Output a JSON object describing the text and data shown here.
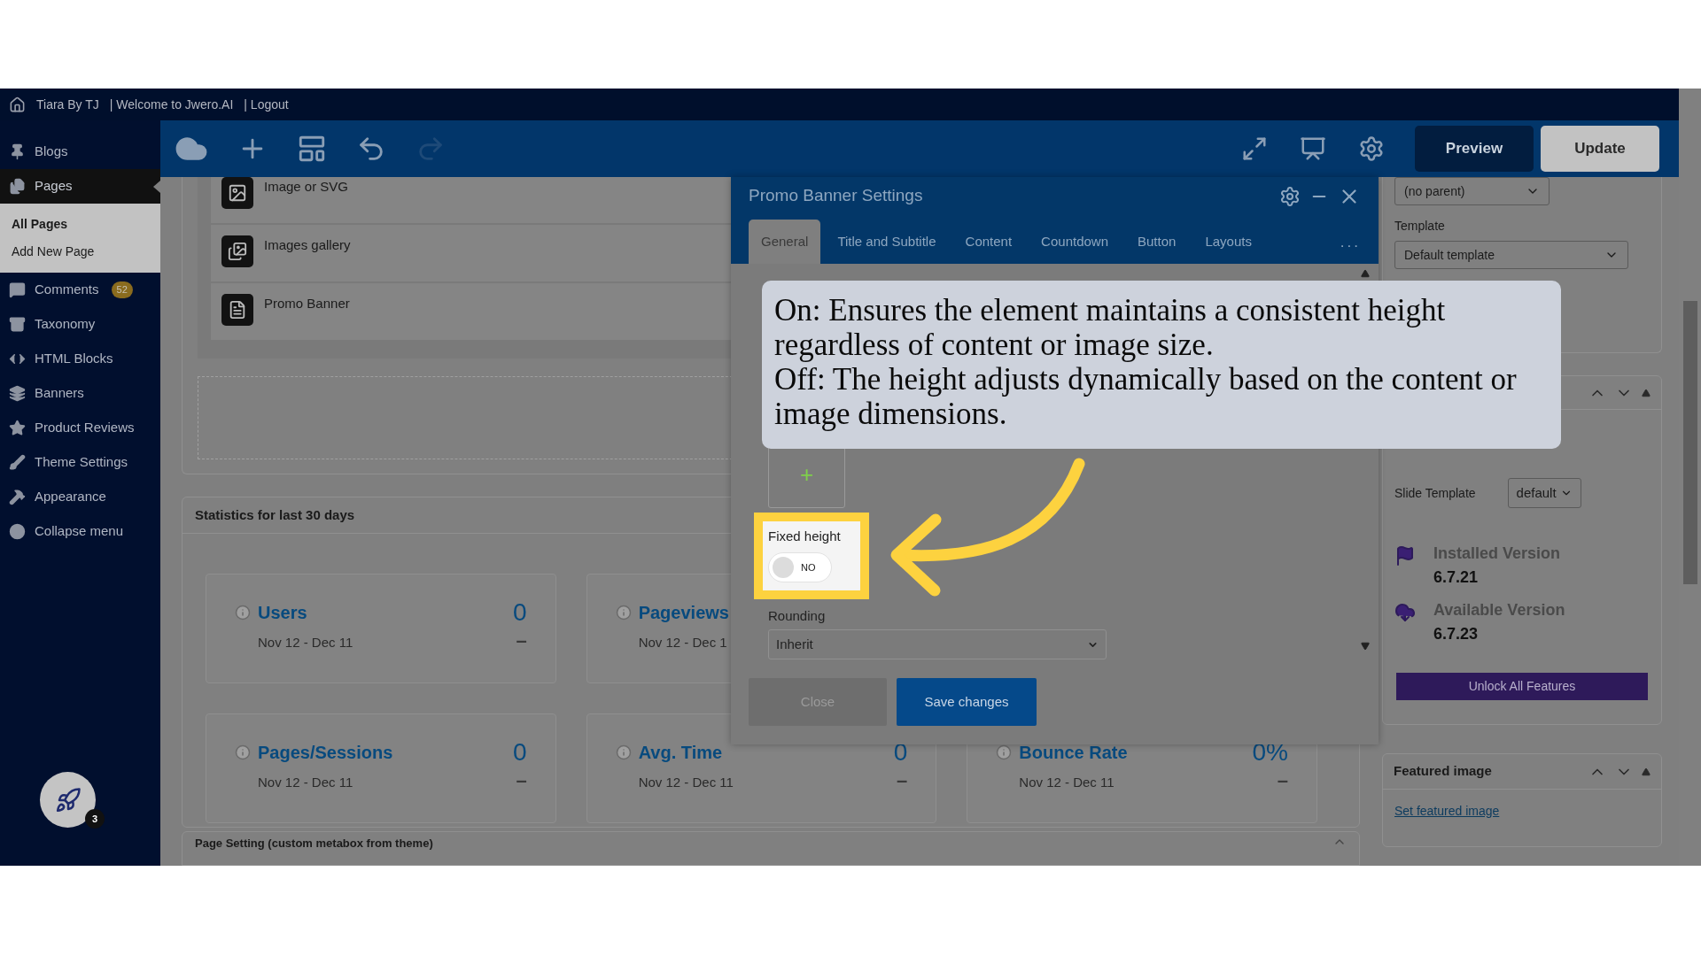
{
  "admin_bar": {
    "items": [
      "Tiara By TJ",
      "| Welcome to Jwero.AI",
      "| Logout"
    ]
  },
  "sidebar": {
    "items": [
      {
        "label": "Blogs",
        "selected": false
      },
      {
        "label": "Pages",
        "selected": true,
        "children": [
          {
            "label": "All Pages",
            "selected": true
          },
          {
            "label": "Add New Page",
            "selected": false
          }
        ]
      },
      {
        "label": "Comments",
        "selected": false,
        "badge": "52"
      },
      {
        "label": "Taxonomy",
        "selected": false
      },
      {
        "label": "HTML Blocks",
        "selected": false
      },
      {
        "label": "Banners",
        "selected": false
      },
      {
        "label": "Product Reviews",
        "selected": false
      },
      {
        "label": "Theme Settings",
        "selected": false
      },
      {
        "label": "Appearance",
        "selected": false
      },
      {
        "label": "Collapse menu",
        "selected": false
      }
    ],
    "launcher_badge": "3"
  },
  "toolbar": {
    "preview": "Preview",
    "update": "Update"
  },
  "elements": [
    "Image or SVG",
    "Images gallery",
    "Promo Banner"
  ],
  "statistics": {
    "title": "Statistics for last 30 days",
    "rows": [
      [
        {
          "label": "Users",
          "range": "Nov 12 - Dec 11",
          "value": "0",
          "delta": "–"
        },
        {
          "label": "Pageviews",
          "range": "Nov 12 - Dec 1"
        }
      ],
      [
        {
          "label": "Pages/Sessions",
          "range": "Nov 12 - Dec 11",
          "value": "0",
          "delta": "–"
        },
        {
          "label": "Avg. Time",
          "range": "Nov 12 - Dec 11",
          "value": "0",
          "delta": "–"
        },
        {
          "label": "Bounce Rate",
          "range": "Nov 12 - Dec 11",
          "value": "0%",
          "delta": "–"
        }
      ]
    ]
  },
  "page_setting": {
    "title": "Page Setting (custom metabox from theme)"
  },
  "modal": {
    "title": "Promo Banner Settings",
    "tabs": [
      {
        "label": "General",
        "selected": true
      },
      {
        "label": "Title and Subtitle",
        "selected": false
      },
      {
        "label": "Content",
        "selected": false
      },
      {
        "label": "Countdown",
        "selected": false
      },
      {
        "label": "Button",
        "selected": false
      },
      {
        "label": "Layouts",
        "selected": false
      }
    ],
    "more": "...",
    "add": "+",
    "fixed_height": {
      "label": "Fixed height",
      "toggle": "NO",
      "on": false
    },
    "rounding": {
      "label": "Rounding",
      "value": "Inherit"
    },
    "buttons": [
      {
        "label": "Close",
        "disabled": true
      },
      {
        "label": "Save changes",
        "disabled": false
      }
    ]
  },
  "tooltip": {
    "paragraphs": [
      "On: Ensures the element maintains a consistent height regardless of content or image size.",
      "Off: The height adjusts dynamically based on the content or image dimensions."
    ]
  },
  "right_panel": {
    "parent_select": "(no parent)",
    "template_label": "Template",
    "template_select": "Default template",
    "slide_template_label": "Slide Template",
    "slide_template_value": "default",
    "versions": [
      {
        "label": "Installed Version",
        "value": "6.7.21"
      },
      {
        "label": "Available Version",
        "value": "6.7.23"
      }
    ],
    "unlock": "Unlock All Features",
    "featured": {
      "title": "Featured image",
      "link": "Set featured image"
    }
  }
}
